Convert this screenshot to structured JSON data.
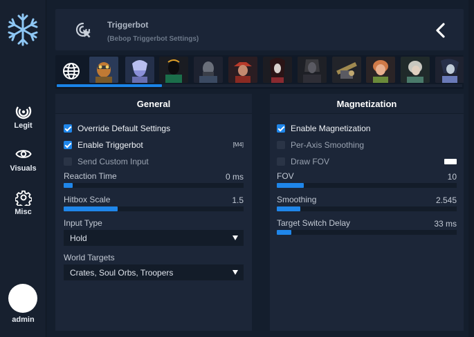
{
  "sidebar": {
    "logo_icon": "snowflake-icon",
    "items": [
      {
        "label": "Legit",
        "icon": "target-rings-icon"
      },
      {
        "label": "Visuals",
        "icon": "eye-icon"
      },
      {
        "label": "Misc",
        "icon": "gear-icon"
      }
    ],
    "user": {
      "name": "admin"
    }
  },
  "header": {
    "icon": "crosshair-cursor-icon",
    "title": "Triggerbot",
    "subtitle": "(Bebop Triggerbot Settings)",
    "back_icon": "chevron-left-icon"
  },
  "hero_strip": {
    "global_icon": "globe-icon",
    "heroes": [
      "Bebop",
      "Dynamo",
      "Infernus",
      "Abrams",
      "Lady Geist",
      "Haze",
      "Kelvin",
      "McGinnis",
      "Ivy",
      "Paradox",
      "Yamato"
    ],
    "selected_hero": "Bebop",
    "scroll_fraction": 0.26
  },
  "general": {
    "title": "General",
    "override_default": {
      "label": "Override Default Settings",
      "checked": true
    },
    "enable_triggerbot": {
      "label": "Enable Triggerbot",
      "checked": true,
      "keybind": "[M4]"
    },
    "send_custom_input": {
      "label": "Send Custom Input",
      "checked": false
    },
    "reaction_time": {
      "label": "Reaction Time",
      "value": "0 ms",
      "fraction": 0.05
    },
    "hitbox_scale": {
      "label": "Hitbox Scale",
      "value": "1.5",
      "fraction": 0.3
    },
    "input_type": {
      "label": "Input Type",
      "value": "Hold"
    },
    "world_targets": {
      "label": "World Targets",
      "value": "Crates, Soul Orbs, Troopers"
    }
  },
  "magnetization": {
    "title": "Magnetization",
    "enable_magnetization": {
      "label": "Enable Magnetization",
      "checked": true
    },
    "per_axis_smoothing": {
      "label": "Per-Axis Smoothing",
      "checked": false
    },
    "draw_fov": {
      "label": "Draw FOV",
      "checked": false,
      "color": "#ffffff"
    },
    "fov": {
      "label": "FOV",
      "value": "10",
      "fraction": 0.15
    },
    "smoothing": {
      "label": "Smoothing",
      "value": "2.545",
      "fraction": 0.13
    },
    "target_switch_delay": {
      "label": "Target Switch Delay",
      "value": "33 ms",
      "fraction": 0.08
    }
  },
  "colors": {
    "accent": "#1f86ea",
    "panel": "#1c2638",
    "background": "#141e2d"
  }
}
